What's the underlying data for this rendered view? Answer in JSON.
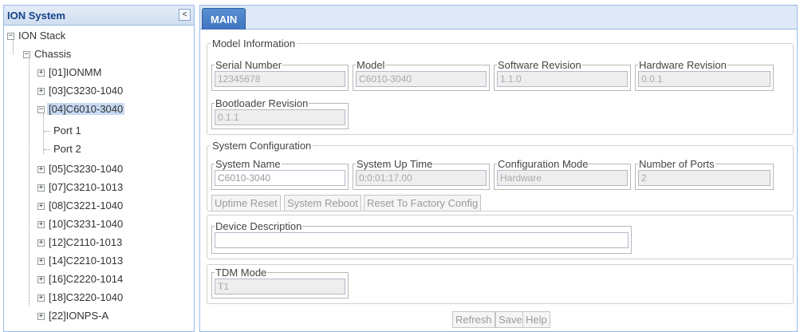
{
  "sidebar": {
    "title": "ION System",
    "collapse_glyph": "<",
    "tree": [
      {
        "label": "ION Stack",
        "expander": "−"
      },
      {
        "label": "Chassis",
        "expander": "−"
      },
      {
        "label": "[01]IONMM",
        "expander": "+"
      },
      {
        "label": "[03]C3230-1040",
        "expander": "+"
      },
      {
        "label": "[04]C6010-3040",
        "expander": "−",
        "selected": true
      },
      {
        "label": "Port 1"
      },
      {
        "label": "Port 2"
      },
      {
        "label": "[05]C3230-1040",
        "expander": "+"
      },
      {
        "label": "[07]C3210-1013",
        "expander": "+"
      },
      {
        "label": "[08]C3221-1040",
        "expander": "+"
      },
      {
        "label": "[10]C3231-1040",
        "expander": "+"
      },
      {
        "label": "[12]C2110-1013",
        "expander": "+"
      },
      {
        "label": "[14]C2210-1013",
        "expander": "+"
      },
      {
        "label": "[16]C2220-1014",
        "expander": "+"
      },
      {
        "label": "[18]C3220-1040",
        "expander": "+"
      },
      {
        "label": "[22]IONPS-A",
        "expander": "+"
      }
    ]
  },
  "main": {
    "tab_label": "MAIN",
    "model_info": {
      "legend": "Model Information",
      "serial_number": {
        "label": "Serial Number",
        "value": "12345678"
      },
      "model": {
        "label": "Model",
        "value": "C6010-3040"
      },
      "software_revision": {
        "label": "Software Revision",
        "value": "1.1.0"
      },
      "hardware_revision": {
        "label": "Hardware Revision",
        "value": "0.0.1"
      },
      "bootloader_revision": {
        "label": "Bootloader Revision",
        "value": "0.1.1"
      }
    },
    "system_config": {
      "legend": "System Configuration",
      "system_name": {
        "label": "System Name",
        "value": "C6010-3040"
      },
      "system_up_time": {
        "label": "System Up Time",
        "value": "0:0:01:17.00"
      },
      "configuration_mode": {
        "label": "Configuration Mode",
        "value": "Hardware"
      },
      "number_of_ports": {
        "label": "Number of Ports",
        "value": "2"
      },
      "uptime_reset_label": "Uptime Reset",
      "system_reboot_label": "System Reboot",
      "factory_reset_label": "Reset To Factory Config"
    },
    "device_description": {
      "label": "Device Description",
      "value": ""
    },
    "tdm_mode": {
      "label": "TDM Mode",
      "value": "T1"
    },
    "footer": {
      "refresh_label": "Refresh",
      "save_label": "Save",
      "help_label": "Help"
    }
  }
}
